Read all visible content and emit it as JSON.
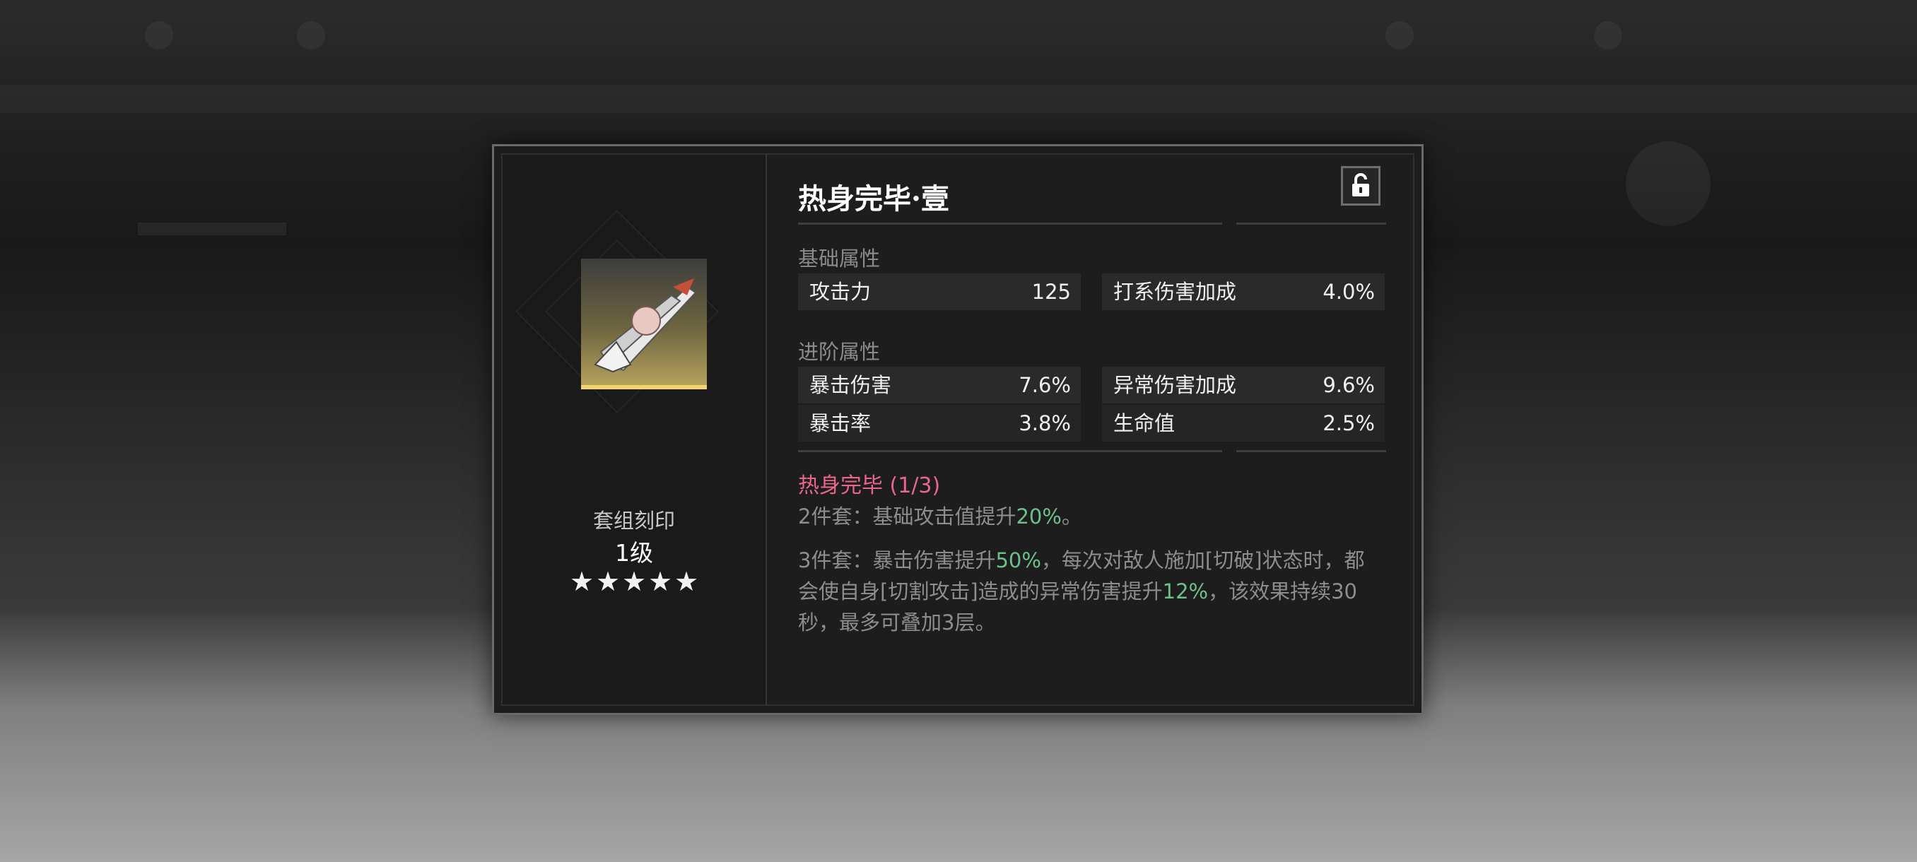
{
  "item": {
    "title": "热身完毕·壹",
    "icon": "unlock-icon"
  },
  "left": {
    "set_label": "套组刻印",
    "level": "1级",
    "stars": [
      "★",
      "★",
      "★",
      "★",
      "★"
    ]
  },
  "base_section": {
    "label": "基础属性",
    "stats": [
      {
        "name": "攻击力",
        "value": "125"
      },
      {
        "name": "打系伤害加成",
        "value": "4.0%"
      }
    ]
  },
  "advanced_section": {
    "label": "进阶属性",
    "stats": [
      {
        "name": "暴击伤害",
        "value": "7.6%"
      },
      {
        "name": "异常伤害加成",
        "value": "9.6%"
      },
      {
        "name": "暴击率",
        "value": "3.8%"
      },
      {
        "name": "生命值",
        "value": "2.5%"
      }
    ]
  },
  "set_bonus": {
    "name": "热身完毕 (1/3)",
    "two_piece": {
      "pre": "2件套：基础攻击值提升",
      "hl": "20%",
      "post": "。"
    },
    "three_piece": {
      "line1_pre": "3件套：暴击伤害提升",
      "line1_hl": "50%",
      "line1_post": "，每次对敌人施加[切破]状态时，都",
      "line2_pre": "会使自身[切割攻击]造成的异常伤害提升",
      "line2_hl": "12%",
      "line2_post": "，该效果持续30",
      "line3": "秒，最多可叠加3层。"
    }
  },
  "colors": {
    "set_name": "#e9678d",
    "highlight": "#6cc08b",
    "rarity_bar": "#f3d36b"
  }
}
